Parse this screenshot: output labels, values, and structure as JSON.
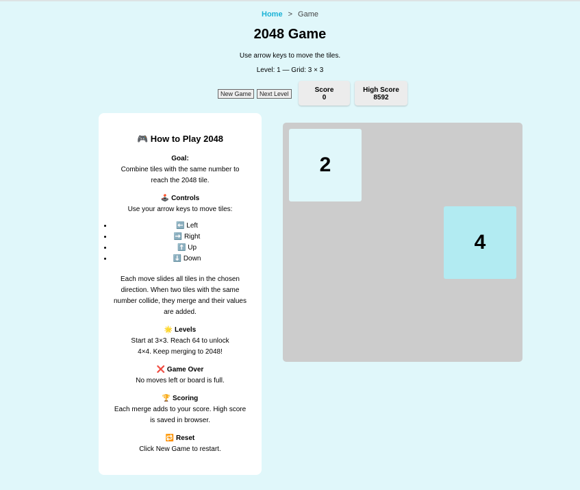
{
  "breadcrumb": {
    "home": "Home",
    "sep": ">",
    "current": "Game"
  },
  "title": "2048 Game",
  "subtitle": "Use arrow keys to move the tiles.",
  "level_info": "Level: 1 — Grid: 3 × 3",
  "buttons": {
    "new_game": "New Game",
    "next_level": "Next Level"
  },
  "score": {
    "label": "Score",
    "value": "0"
  },
  "high_score": {
    "label": "High Score",
    "value": "8592"
  },
  "help": {
    "title": "How to Play 2048",
    "title_icon": "🎮",
    "goal_head": "Goal:",
    "goal_text": "Combine tiles with the same number to reach the 2048 tile.",
    "controls_icon": "🕹️",
    "controls_head": "Controls",
    "controls_text": "Use your arrow keys to move tiles:",
    "keys": [
      {
        "icon": "⬅️",
        "label": "Left"
      },
      {
        "icon": "➡️",
        "label": "Right"
      },
      {
        "icon": "⬆️",
        "label": "Up"
      },
      {
        "icon": "⬇️",
        "label": "Down"
      }
    ],
    "move_text": "Each move slides all tiles in the chosen direction. When two tiles with the same number collide, they merge and their values are added.",
    "levels_icon": "🌟",
    "levels_head": "Levels",
    "levels_text": "Start at 3×3. Reach 64 to unlock 4×4. Keep merging to 2048!",
    "over_icon": "❌",
    "over_head": "Game Over",
    "over_text": "No moves left or board is full.",
    "scoring_icon": "🏆",
    "scoring_head": "Scoring",
    "scoring_text": "Each merge adds to your score. High score is saved in browser.",
    "reset_icon": "🔁",
    "reset_head": "Reset",
    "reset_text": "Click New Game to restart."
  },
  "board": {
    "size": 3,
    "tiles": [
      {
        "row": 0,
        "col": 0,
        "value": "2",
        "color": "#e0f7fa"
      },
      {
        "row": 1,
        "col": 2,
        "value": "4",
        "color": "#b2ebf2"
      }
    ]
  }
}
